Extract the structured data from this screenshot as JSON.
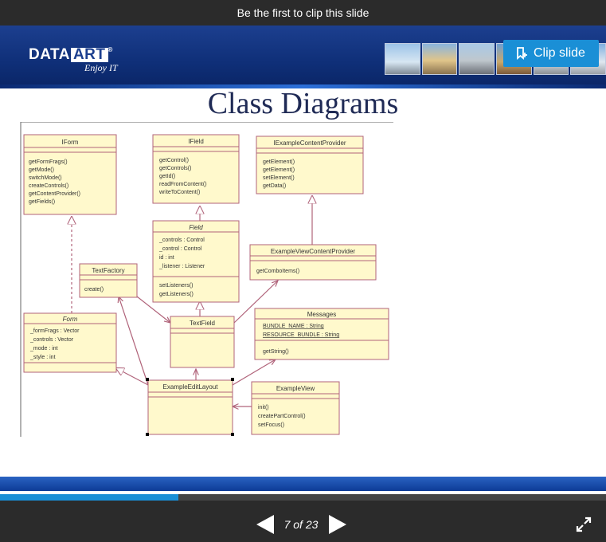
{
  "topbar": {
    "message": "Be the first to clip this slide"
  },
  "banner": {
    "logo_left": "DATA",
    "logo_right": "ART",
    "logo_reg": "®",
    "tagline": "Enjoy IT",
    "clip_label": "Clip slide"
  },
  "slide": {
    "title": "Class Diagrams",
    "classes": {
      "iform": {
        "name": "IForm",
        "methods": [
          "getFormFrags()",
          "getMode()",
          "switchMode()",
          "createControls()",
          "getContentProvider()",
          "getFields()"
        ]
      },
      "ifield": {
        "name": "IField",
        "methods": [
          "getControl()",
          "getControls()",
          "getId()",
          "readFromContent()",
          "writeToContent()"
        ]
      },
      "iexample": {
        "name": "IExampleContentProvider",
        "methods": [
          "getElement()",
          "getElement()",
          "setElement()",
          "getData()"
        ]
      },
      "field": {
        "name": "Field",
        "attributes": [
          "_controls : Control",
          "_control : Control",
          "id : int",
          "_listener : Listener"
        ],
        "methods": [
          "setListeners()",
          "getListeners()"
        ]
      },
      "exampleview_cp": {
        "name": "ExampleViewContentProvider",
        "methods": [
          "getComboItems()"
        ]
      },
      "textfactory": {
        "name": "TextFactory",
        "methods": [
          "create()"
        ]
      },
      "textfield": {
        "name": "TextField"
      },
      "messages": {
        "name": "Messages",
        "attributes": [
          "BUNDLE_NAME : String",
          "RESOURCE_BUNDLE : String"
        ],
        "methods": [
          "getString()"
        ]
      },
      "form": {
        "name": "Form",
        "attributes": [
          "_formFrags : Vector",
          "_controls : Vector",
          "_mode : int",
          "_style : int"
        ]
      },
      "editlayout": {
        "name": "ExampleEditLayout"
      },
      "exampleview": {
        "name": "ExampleView",
        "methods": [
          "init()",
          "createPartControl()",
          "setFocus()"
        ]
      }
    }
  },
  "pager": {
    "current": "7",
    "separator": "of",
    "total": "23",
    "progress_fraction": 0.295
  },
  "colors": {
    "accent": "#1a8fd6",
    "box_fill": "#fff9cc",
    "box_border": "#b0637a"
  }
}
